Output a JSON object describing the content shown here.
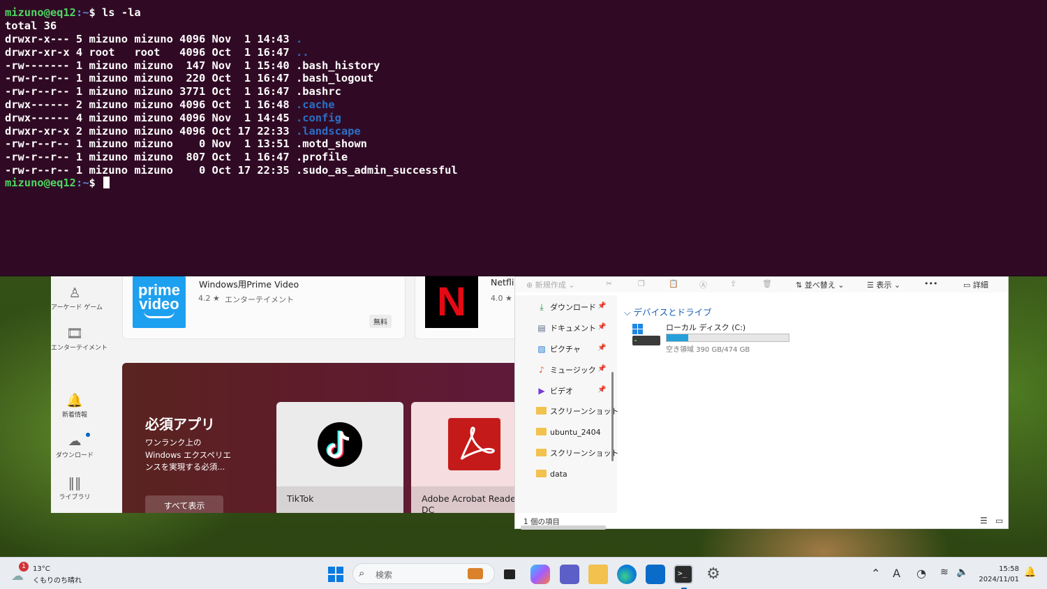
{
  "terminal": {
    "prompt_user": "mizuno@eq12",
    "prompt_path": ":~",
    "prompt_symbol": "$ ",
    "command": "ls -la",
    "total": "total 36",
    "entries": [
      {
        "info": "drwxr-x--- 5 mizuno mizuno 4096 Nov  1 14:43 ",
        "name": ".",
        "dir": true
      },
      {
        "info": "drwxr-xr-x 4 root   root   4096 Oct  1 16:47 ",
        "name": "..",
        "dir": true
      },
      {
        "info": "-rw------- 1 mizuno mizuno  147 Nov  1 15:40 ",
        "name": ".bash_history",
        "dir": false
      },
      {
        "info": "-rw-r--r-- 1 mizuno mizuno  220 Oct  1 16:47 ",
        "name": ".bash_logout",
        "dir": false
      },
      {
        "info": "-rw-r--r-- 1 mizuno mizuno 3771 Oct  1 16:47 ",
        "name": ".bashrc",
        "dir": false
      },
      {
        "info": "drwx------ 2 mizuno mizuno 4096 Oct  1 16:48 ",
        "name": ".cache",
        "dir": true
      },
      {
        "info": "drwx------ 4 mizuno mizuno 4096 Nov  1 14:45 ",
        "name": ".config",
        "dir": true
      },
      {
        "info": "drwxr-xr-x 2 mizuno mizuno 4096 Oct 17 22:33 ",
        "name": ".landscape",
        "dir": true
      },
      {
        "info": "-rw-r--r-- 1 mizuno mizuno    0 Nov  1 13:51 ",
        "name": ".motd_shown",
        "dir": false
      },
      {
        "info": "-rw-r--r-- 1 mizuno mizuno  807 Oct  1 16:47 ",
        "name": ".profile",
        "dir": false
      },
      {
        "info": "-rw-r--r-- 1 mizuno mizuno    0 Oct 17 22:35 ",
        "name": ".sudo_as_admin_successful",
        "dir": false
      }
    ]
  },
  "store": {
    "nav": [
      {
        "label": "アーケード ゲーム",
        "icon": "joystick-icon"
      },
      {
        "label": "エンターテイメント",
        "icon": "film-icon"
      },
      {
        "label": "新着情報",
        "icon": "bell-icon"
      },
      {
        "label": "ダウンロード",
        "icon": "cloud-download-icon"
      },
      {
        "label": "ライブラリ",
        "icon": "library-icon"
      }
    ],
    "app1": {
      "title": "Windows用Prime Video",
      "rating": "4.2 ★",
      "category": "エンターテイメント",
      "price": "無料",
      "logo_top": "prime",
      "logo_bottom": "video"
    },
    "app2": {
      "title": "Netfli",
      "rating": "4.0 ★",
      "logo": "N"
    },
    "hero": {
      "title": "必須アプリ",
      "desc": "ワンランク上の Windows エクスペリエンスを実現する必須...",
      "button": "すべて表示"
    },
    "cards": [
      {
        "name": "TikTok"
      },
      {
        "name": "Adobe Acrobat Reader DC"
      }
    ]
  },
  "explorer": {
    "toolbar": {
      "new": "新規作成",
      "sort": "並べ替え",
      "view": "表示",
      "more": "•••",
      "details": "詳細"
    },
    "nav": [
      {
        "label": "ダウンロード",
        "pinned": true,
        "icon": "download-icon"
      },
      {
        "label": "ドキュメント",
        "pinned": true,
        "icon": "document-icon"
      },
      {
        "label": "ピクチャ",
        "pinned": true,
        "icon": "picture-icon"
      },
      {
        "label": "ミュージック",
        "pinned": true,
        "icon": "music-icon"
      },
      {
        "label": "ビデオ",
        "pinned": true,
        "icon": "video-icon"
      },
      {
        "label": "スクリーンショット",
        "pinned": false,
        "icon": "folder-icon"
      },
      {
        "label": "ubuntu_2404",
        "pinned": false,
        "icon": "folder-icon"
      },
      {
        "label": "スクリーンショット",
        "pinned": false,
        "icon": "folder-icon"
      },
      {
        "label": "data",
        "pinned": false,
        "icon": "folder-icon"
      }
    ],
    "section": "デバイスとドライブ",
    "drive": {
      "name": "ローカル ディスク (C:)",
      "free": "空き領域 390 GB/474 GB",
      "used_fraction": 0.177
    },
    "status": "1 個の項目"
  },
  "taskbar": {
    "weather_temp": "13°C",
    "weather_desc": "くもりのち晴れ",
    "weather_badge": "1",
    "search_placeholder": "検索",
    "ime": "A",
    "time": "15:58",
    "date": "2024/11/01",
    "colors": {
      "accent": "#0067c0"
    }
  }
}
